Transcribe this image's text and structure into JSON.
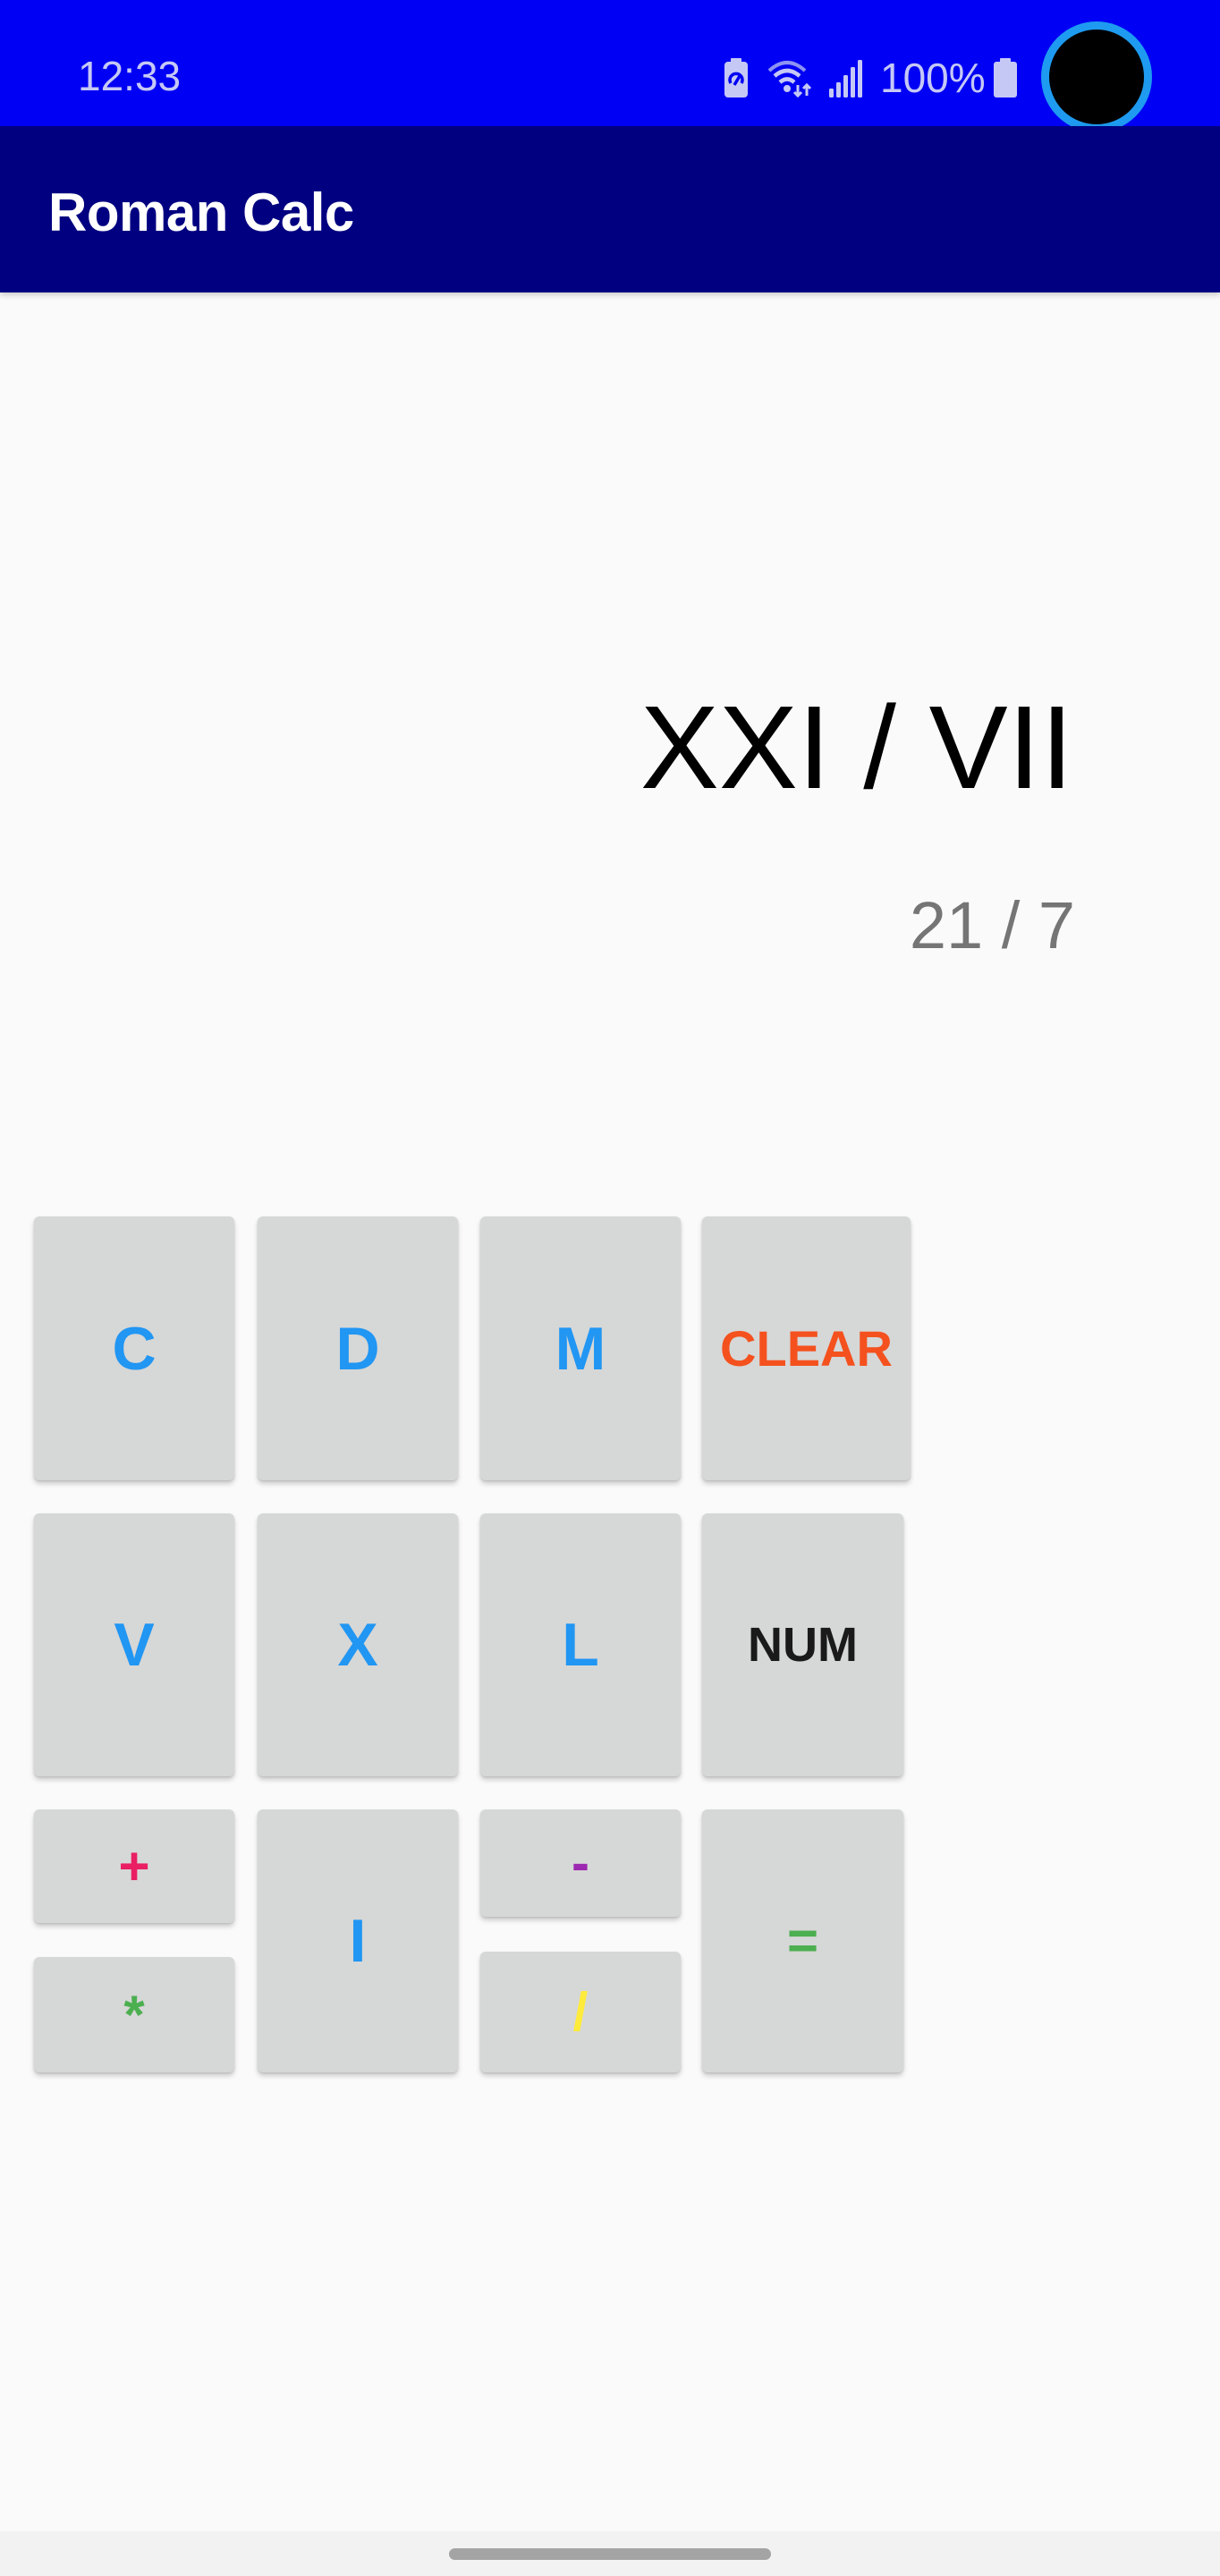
{
  "status_bar": {
    "time": "12:33",
    "battery_percent": "100%",
    "icons": [
      "battery-saver-icon",
      "wifi-icon",
      "cellular-signal-icon",
      "battery-icon"
    ],
    "color": "#0000F5"
  },
  "toolbar": {
    "title": "Roman Calc",
    "color": "#000080"
  },
  "display": {
    "expression_roman": "XXI / VII",
    "expression_numeric": "21 / 7"
  },
  "keypad": {
    "row1": [
      {
        "label": "C",
        "name": "key-c",
        "color": "#2196F3"
      },
      {
        "label": "D",
        "name": "key-d",
        "color": "#2196F3"
      },
      {
        "label": "M",
        "name": "key-m",
        "color": "#2196F3"
      },
      {
        "label": "CLEAR",
        "name": "clear-button",
        "color": "#F4511E"
      }
    ],
    "row2": [
      {
        "label": "V",
        "name": "key-v",
        "color": "#2196F3"
      },
      {
        "label": "X",
        "name": "key-x",
        "color": "#2196F3"
      },
      {
        "label": "L",
        "name": "key-l",
        "color": "#2196F3"
      },
      {
        "label": "NUM",
        "name": "num-toggle-button",
        "color": "#1A1A1A"
      }
    ],
    "row3": {
      "plus": {
        "label": "+",
        "color": "#E91E63"
      },
      "multiply": {
        "label": "*",
        "color": "#4CAF50"
      },
      "one": {
        "label": "I",
        "color": "#2196F3"
      },
      "minus": {
        "label": "-",
        "color": "#9C27B0"
      },
      "divide": {
        "label": "/",
        "color": "#FFEB3B"
      },
      "equals": {
        "label": "=",
        "color": "#4CAF50"
      }
    }
  }
}
